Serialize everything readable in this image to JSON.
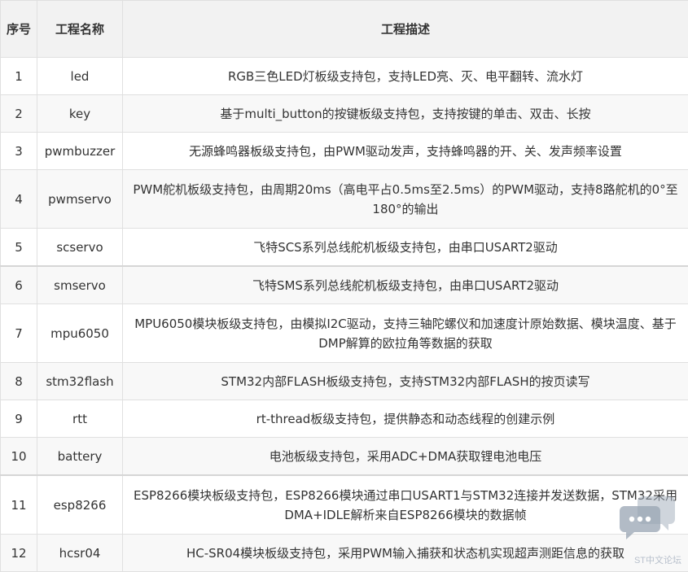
{
  "table": {
    "headers": {
      "seq": "序号",
      "name": "工程名称",
      "desc": "工程描述"
    },
    "rows": [
      {
        "no": "1",
        "name": "led",
        "desc": "RGB三色LED灯板级支持包，支持LED亮、灭、电平翻转、流水灯"
      },
      {
        "no": "2",
        "name": "key",
        "desc": "基于multi_button的按键板级支持包，支持按键的单击、双击、长按"
      },
      {
        "no": "3",
        "name": "pwmbuzzer",
        "desc": "无源蜂鸣器板级支持包，由PWM驱动发声，支持蜂鸣器的开、关、发声频率设置"
      },
      {
        "no": "4",
        "name": "pwmservo",
        "desc": "PWM舵机板级支持包，由周期20ms（高电平占0.5ms至2.5ms）的PWM驱动，支持8路舵机的0°至180°的输出"
      },
      {
        "no": "5",
        "name": "scservo",
        "desc": "飞特SCS系列总线舵机板级支持包，由串口USART2驱动"
      },
      {
        "no": "6",
        "name": "smservo",
        "desc": "飞特SMS系列总线舵机板级支持包，由串口USART2驱动"
      },
      {
        "no": "7",
        "name": "mpu6050",
        "desc": "MPU6050模块板级支持包，由模拟I2C驱动，支持三轴陀螺仪和加速度计原始数据、模块温度、基于DMP解算的欧拉角等数据的获取"
      },
      {
        "no": "8",
        "name": "stm32flash",
        "desc": "STM32内部FLASH板级支持包，支持STM32内部FLASH的按页读写"
      },
      {
        "no": "9",
        "name": "rtt",
        "desc": "rt-thread板级支持包，提供静态和动态线程的创建示例"
      },
      {
        "no": "10",
        "name": "battery",
        "desc": "电池板级支持包，采用ADC+DMA获取锂电池电压"
      },
      {
        "no": "11",
        "name": "esp8266",
        "desc": "ESP8266模块板级支持包，ESP8266模块通过串口USART1与STM32连接并发送数据，STM32采用DMA+IDLE解析来自ESP8266模块的数据帧"
      },
      {
        "no": "12",
        "name": "hcsr04",
        "desc": "HC-SR04模块板级支持包，采用PWM输入捕获和状态机实现超声测距信息的获取"
      }
    ]
  },
  "watermark": {
    "icon": "chat-bubbles-icon",
    "text": "ST中文论坛",
    "color": "#b8c0cc"
  }
}
